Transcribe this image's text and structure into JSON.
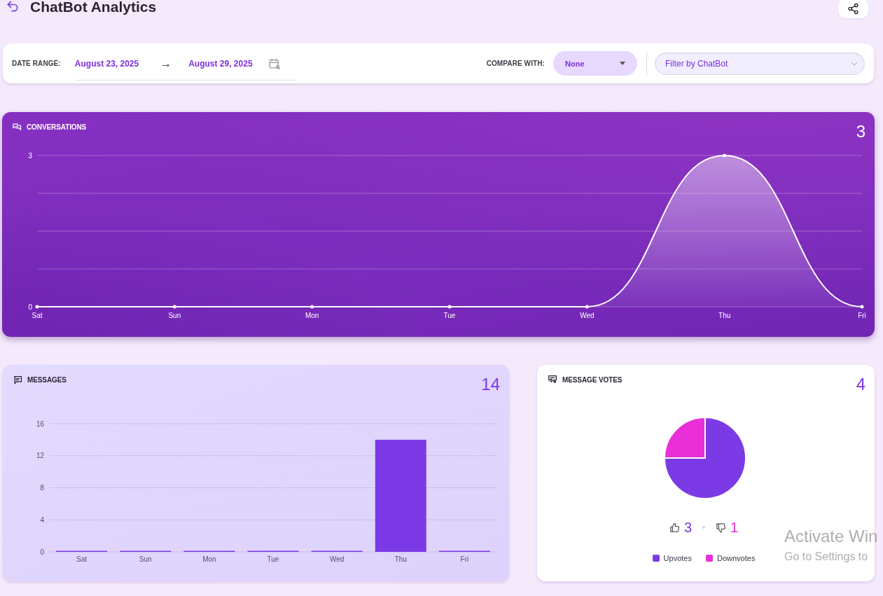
{
  "header": {
    "title": "ChatBot Analytics"
  },
  "filters": {
    "date_range_label": "DATE RANGE:",
    "start_date": "August 23, 2025",
    "arrow": "→",
    "end_date": "August 29, 2025",
    "compare_label": "COMPARE WITH:",
    "compare_value": "None",
    "chatbot_filter": {
      "placeholder": "Filter by ChatBot"
    }
  },
  "conversations": {
    "title": "CONVERSATIONS",
    "total": "3",
    "chart_data": {
      "type": "area",
      "categories": [
        "Sat",
        "Sun",
        "Mon",
        "Tue",
        "Wed",
        "Thu",
        "Fri"
      ],
      "series": [
        {
          "color": "#ffffff",
          "values": [
            0,
            0,
            0,
            0,
            0,
            3,
            0
          ]
        }
      ],
      "ylim": [
        0,
        3
      ],
      "yticks": [
        0,
        3
      ],
      "grid": true
    }
  },
  "messages": {
    "title": "MESSAGES",
    "total": "14",
    "chart_data": {
      "type": "bar",
      "categories": [
        "Sat",
        "Sun",
        "Mon",
        "Tue",
        "Wed",
        "Thu",
        "Fri"
      ],
      "series": [
        {
          "color": "#7b3ae6",
          "values": [
            0,
            0,
            0,
            0,
            0,
            14,
            0
          ]
        }
      ],
      "ylim": [
        0,
        16
      ],
      "yticks": [
        0,
        4,
        8,
        12,
        16
      ],
      "grid": true
    }
  },
  "votes": {
    "title": "MESSAGE VOTES",
    "total": "4",
    "upvotes": "3",
    "downvotes": "1",
    "chart_data": {
      "type": "pie",
      "categories": [
        "Upvotes",
        "Downvotes"
      ],
      "values": [
        75,
        25
      ]
    },
    "legend": [
      {
        "color": "#7b3ae6"
      },
      {
        "color": "#e830d6"
      }
    ]
  },
  "os_notice": {
    "title": "Activate Win",
    "subtitle": "Go to Settings to"
  }
}
